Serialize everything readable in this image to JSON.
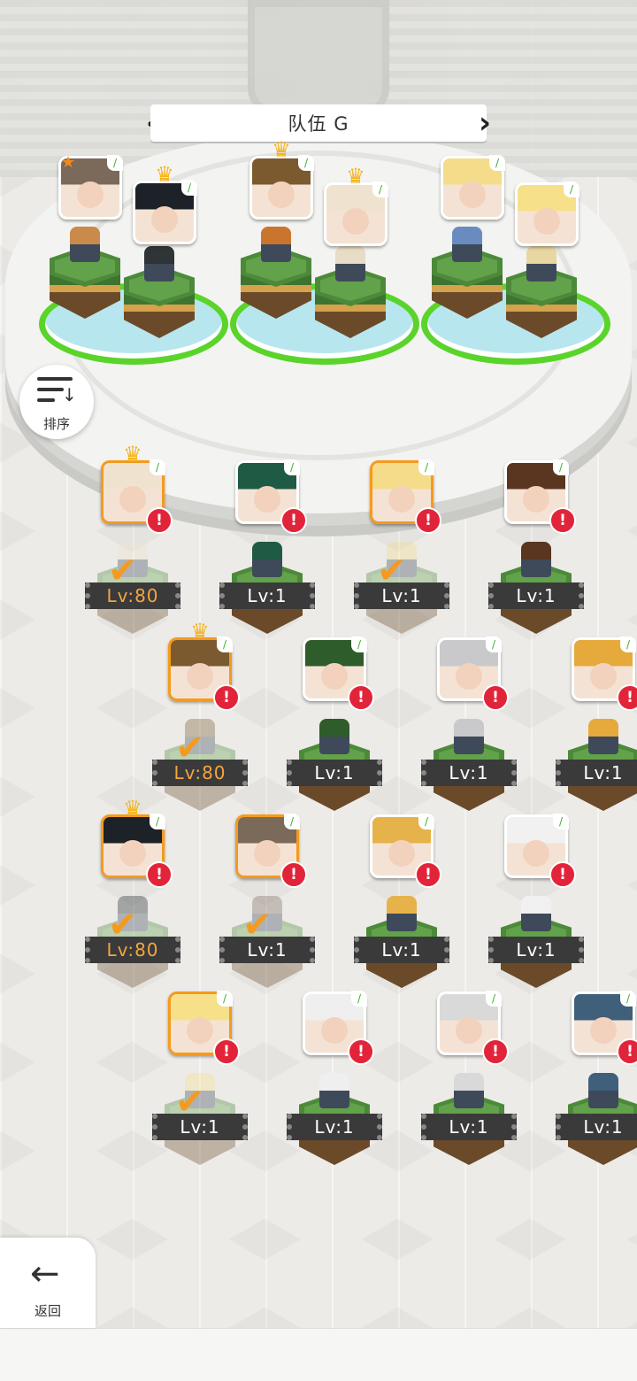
{
  "team": {
    "label": "队伍 G",
    "prev_arrow": "‹",
    "next_arrow": "›"
  },
  "sort_button": {
    "label": "排序",
    "icon": "sort-icon"
  },
  "back_button": {
    "label": "返回",
    "icon": "arrow-left-icon"
  },
  "formation": [
    {
      "name": "slot-1",
      "hair": "#7b6a5a",
      "sprite": "#c98a4a",
      "crown": false,
      "star": true
    },
    {
      "name": "slot-2",
      "hair": "#1d2228",
      "sprite": "#2f3436",
      "crown": true,
      "star": false
    },
    {
      "name": "slot-3",
      "hair": "#7a5a2e",
      "sprite": "#c9752e",
      "crown": true,
      "star": false
    },
    {
      "name": "slot-4",
      "hair": "#efe3cf",
      "sprite": "#e8dcc6",
      "crown": true,
      "star": false
    },
    {
      "name": "slot-5",
      "hair": "#f4dc8a",
      "sprite": "#6a8bbf",
      "crown": false,
      "star": false
    },
    {
      "name": "slot-6",
      "hair": "#f6e08a",
      "sprite": "#e9d7a2",
      "crown": false,
      "star": false
    }
  ],
  "roster": [
    {
      "level": "Lv:80",
      "selected": true,
      "crown": true,
      "hair": "#efe3cf"
    },
    {
      "level": "Lv:1",
      "selected": false,
      "crown": false,
      "hair": "#1e5a44"
    },
    {
      "level": "Lv:1",
      "selected": true,
      "crown": false,
      "hair": "#f4dc8a"
    },
    {
      "level": "Lv:1",
      "selected": false,
      "crown": false,
      "hair": "#5a3520"
    },
    {
      "level": "Lv:80",
      "selected": true,
      "crown": true,
      "hair": "#7a5a2e"
    },
    {
      "level": "Lv:1",
      "selected": false,
      "crown": false,
      "hair": "#2e5c2a"
    },
    {
      "level": "Lv:1",
      "selected": false,
      "crown": false,
      "hair": "#c9c9cc"
    },
    {
      "level": "Lv:1",
      "selected": false,
      "crown": false,
      "hair": "#e6a93c"
    },
    {
      "level": "Lv:80",
      "selected": true,
      "crown": true,
      "hair": "#1d2228"
    },
    {
      "level": "Lv:1",
      "selected": true,
      "crown": false,
      "hair": "#7b6a5a"
    },
    {
      "level": "Lv:1",
      "selected": false,
      "crown": false,
      "hair": "#e6b24a"
    },
    {
      "level": "Lv:1",
      "selected": false,
      "crown": false,
      "hair": "#f1f1f1"
    },
    {
      "level": "Lv:1",
      "selected": true,
      "crown": false,
      "hair": "#f6e08a"
    },
    {
      "level": "Lv:1",
      "selected": false,
      "crown": false,
      "hair": "#efefef"
    },
    {
      "level": "Lv:1",
      "selected": false,
      "crown": false,
      "hair": "#d9d9d9"
    },
    {
      "level": "Lv:1",
      "selected": false,
      "crown": false,
      "hair": "#3f5f7a"
    }
  ],
  "colors": {
    "selected_border": "#f59a1e",
    "alert": "#e2243a",
    "slot_ring": "#5ad42a",
    "level_bar": "#3a3a3a"
  }
}
